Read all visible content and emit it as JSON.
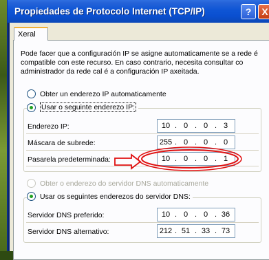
{
  "window": {
    "title": "Propiedades de Protocolo Internet (TCP/IP)",
    "help_label": "?",
    "close_label": "X"
  },
  "tab": {
    "label": "Xeral"
  },
  "description": "Pode facer que a configuración IP se asigne automaticamente se a rede é compatible con este recurso. En caso contrario, necesita consultar co administrador da rede cal é a configuración IP axeitada.",
  "ip_options": {
    "auto_label": "Obter un enderezo IP automaticamente",
    "manual_label": "Usar o seguinte enderezo IP:",
    "selected": "manual"
  },
  "ip_fields": [
    {
      "label": "Enderezo IP:",
      "octets": [
        "10",
        "0",
        "0",
        "3"
      ]
    },
    {
      "label": "Máscara de subrede:",
      "octets": [
        "255",
        "0",
        "0",
        "0"
      ]
    },
    {
      "label": "Pasarela predeterminada:",
      "octets": [
        "10",
        "0",
        "0",
        "1"
      ]
    }
  ],
  "dns_options": {
    "auto_label": "Obter o enderezo do servidor DNS automaticamente",
    "manual_label": "Usar os seguintes enderezos do servidor DNS:",
    "selected": "manual"
  },
  "dns_fields": [
    {
      "label": "Servidor DNS preferido:",
      "octets": [
        "10",
        "0",
        "0",
        "36"
      ]
    },
    {
      "label": "Servidor DNS alternativo:",
      "octets": [
        "212",
        "51",
        "33",
        "73"
      ]
    }
  ],
  "annotation_color": "#e01010"
}
